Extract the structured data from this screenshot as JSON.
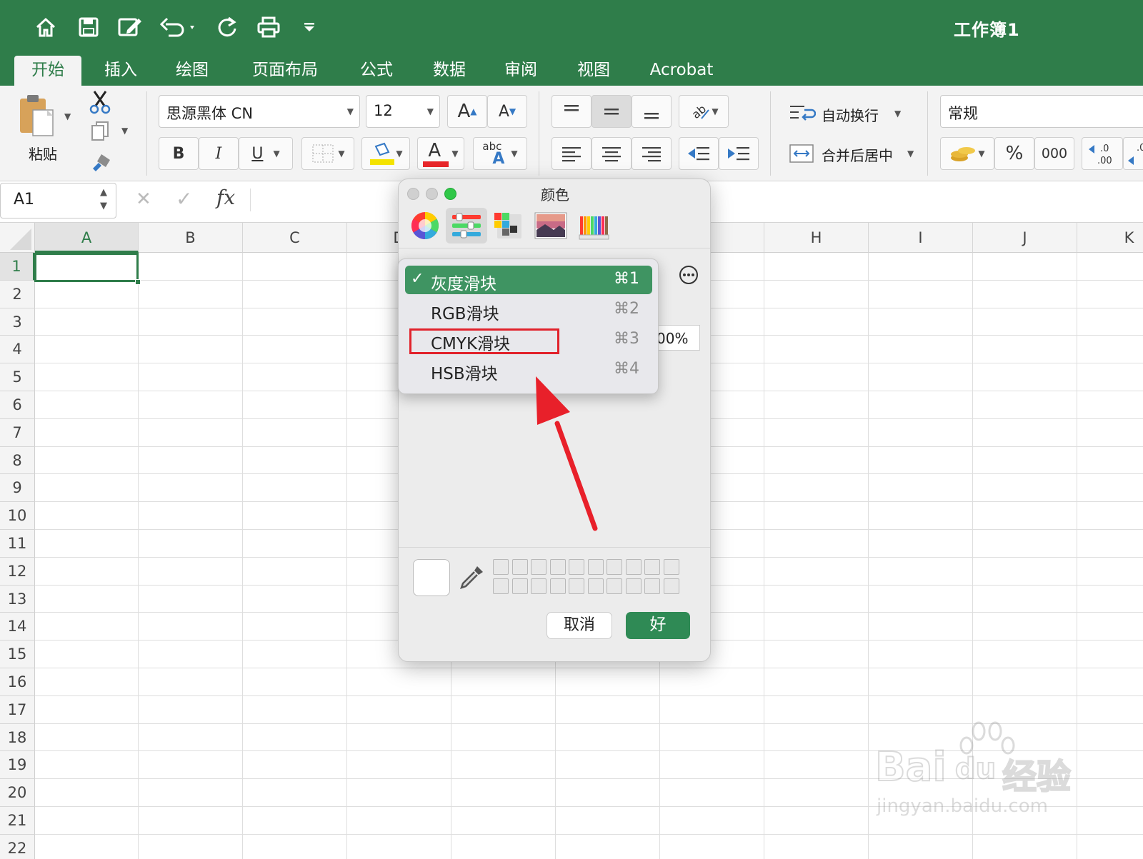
{
  "window": {
    "title": "工作簿1"
  },
  "quick_access": [
    "home-icon",
    "save-icon",
    "edit-icon",
    "undo-icon",
    "redo-icon",
    "print-icon",
    "customize-icon"
  ],
  "tabs": [
    {
      "label": "开始",
      "active": true
    },
    {
      "label": "插入"
    },
    {
      "label": "绘图"
    },
    {
      "label": "页面布局"
    },
    {
      "label": "公式"
    },
    {
      "label": "数据"
    },
    {
      "label": "审阅"
    },
    {
      "label": "视图"
    },
    {
      "label": "Acrobat"
    }
  ],
  "ribbon": {
    "paste_label": "粘贴",
    "font_name": "思源黑体 CN",
    "font_size": "12",
    "bold": "B",
    "italic": "I",
    "underline": "U",
    "increase_font": "A",
    "decrease_font": "A",
    "font_color_letter": "A",
    "abc": "abc",
    "abc_a": "A",
    "wrap_text": "自动换行",
    "merge_center": "合并后居中",
    "number_format": "常规",
    "percent": "%",
    "thousands": "000",
    "inc_decimal": ".0\n.00",
    "accent_fill": "#f4e300",
    "accent_font": "#e8272b"
  },
  "formula_bar": {
    "cell_ref": "A1",
    "fx": "fx",
    "cancel": "✕",
    "confirm": "✓"
  },
  "grid": {
    "columns": [
      "A",
      "B",
      "C",
      "D",
      "",
      "",
      "",
      "H",
      "I",
      "J",
      "K"
    ],
    "rows": [
      "1",
      "2",
      "3",
      "4",
      "5",
      "6",
      "7",
      "8",
      "9",
      "10",
      "11",
      "12",
      "13",
      "14",
      "15",
      "16",
      "17",
      "18",
      "19",
      "20",
      "21",
      "22"
    ],
    "selected_cell": "A1"
  },
  "color_dialog": {
    "title": "颜色",
    "modes": [
      "color-wheel-icon",
      "sliders-icon",
      "palettes-icon",
      "image-palettes-icon",
      "pencils-icon"
    ],
    "selected_mode": 1,
    "opacity_partial": "00%",
    "menu_items": [
      {
        "label": "灰度滑块",
        "shortcut": "⌘1",
        "checked": true
      },
      {
        "label": "RGB滑块",
        "shortcut": "⌘2",
        "checked": false
      },
      {
        "label": "CMYK滑块",
        "shortcut": "⌘3",
        "checked": false,
        "highlighted": true
      },
      {
        "label": "HSB滑块",
        "shortcut": "⌘4",
        "checked": false
      }
    ],
    "checkmark": "✓",
    "cancel": "取消",
    "ok": "好"
  },
  "watermark": {
    "brand": "Bai",
    "brand_du": "du",
    "brand_cn": "经验",
    "url": "jingyan.baidu.com"
  }
}
